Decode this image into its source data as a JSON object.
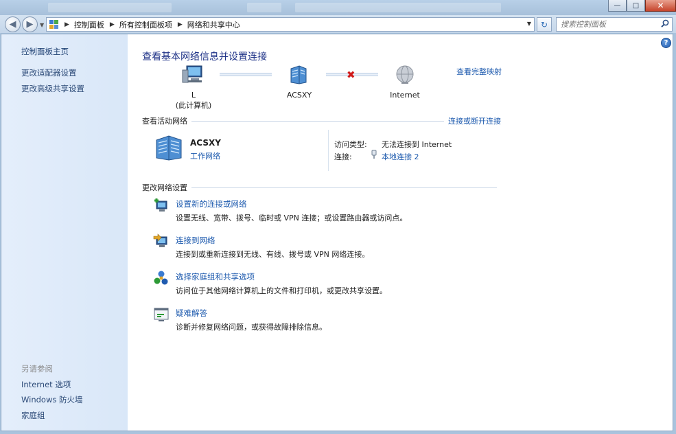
{
  "window": {
    "minimize_glyph": "—",
    "maximize_glyph": "□",
    "close_glyph": "✕"
  },
  "nav": {
    "back_glyph": "◀",
    "forward_glyph": "▶",
    "breadcrumb": [
      "控制面板",
      "所有控制面板项",
      "网络和共享中心"
    ],
    "search_placeholder": "搜索控制面板",
    "refresh_glyph": "↻"
  },
  "sidebar": {
    "home": "控制面板主页",
    "items": [
      "更改适配器设置",
      "更改高级共享设置"
    ],
    "see_also_heading": "另请参阅",
    "see_also": [
      "Internet 选项",
      "Windows 防火墙",
      "家庭组"
    ]
  },
  "main": {
    "title": "查看基本网络信息并设置连接",
    "full_map_link": "查看完整映射",
    "help_glyph": "?",
    "map": {
      "computer_name": "L",
      "computer_sub": "(此计算机)",
      "network_name": "ACSXY",
      "internet_label": "Internet",
      "x_glyph": "✖"
    },
    "active": {
      "heading": "查看活动网络",
      "connect_link": "连接或断开连接",
      "network_name": "ACSXY",
      "network_type": "工作网络",
      "access_type_label": "访问类型:",
      "access_type_value": "无法连接到 Internet",
      "connection_label": "连接:",
      "connection_value": "本地连接 2"
    },
    "change": {
      "heading": "更改网络设置",
      "tasks": [
        {
          "link": "设置新的连接或网络",
          "desc": "设置无线、宽带、拨号、临时或 VPN 连接；或设置路由器或访问点。",
          "icon": "new-connection-icon"
        },
        {
          "link": "连接到网络",
          "desc": "连接到或重新连接到无线、有线、拨号或 VPN 网络连接。",
          "icon": "connect-network-icon"
        },
        {
          "link": "选择家庭组和共享选项",
          "desc": "访问位于其他网络计算机上的文件和打印机，或更改共享设置。",
          "icon": "homegroup-icon"
        },
        {
          "link": "疑难解答",
          "desc": "诊断并修复网络问题，或获得故障排除信息。",
          "icon": "troubleshoot-icon"
        }
      ]
    }
  }
}
